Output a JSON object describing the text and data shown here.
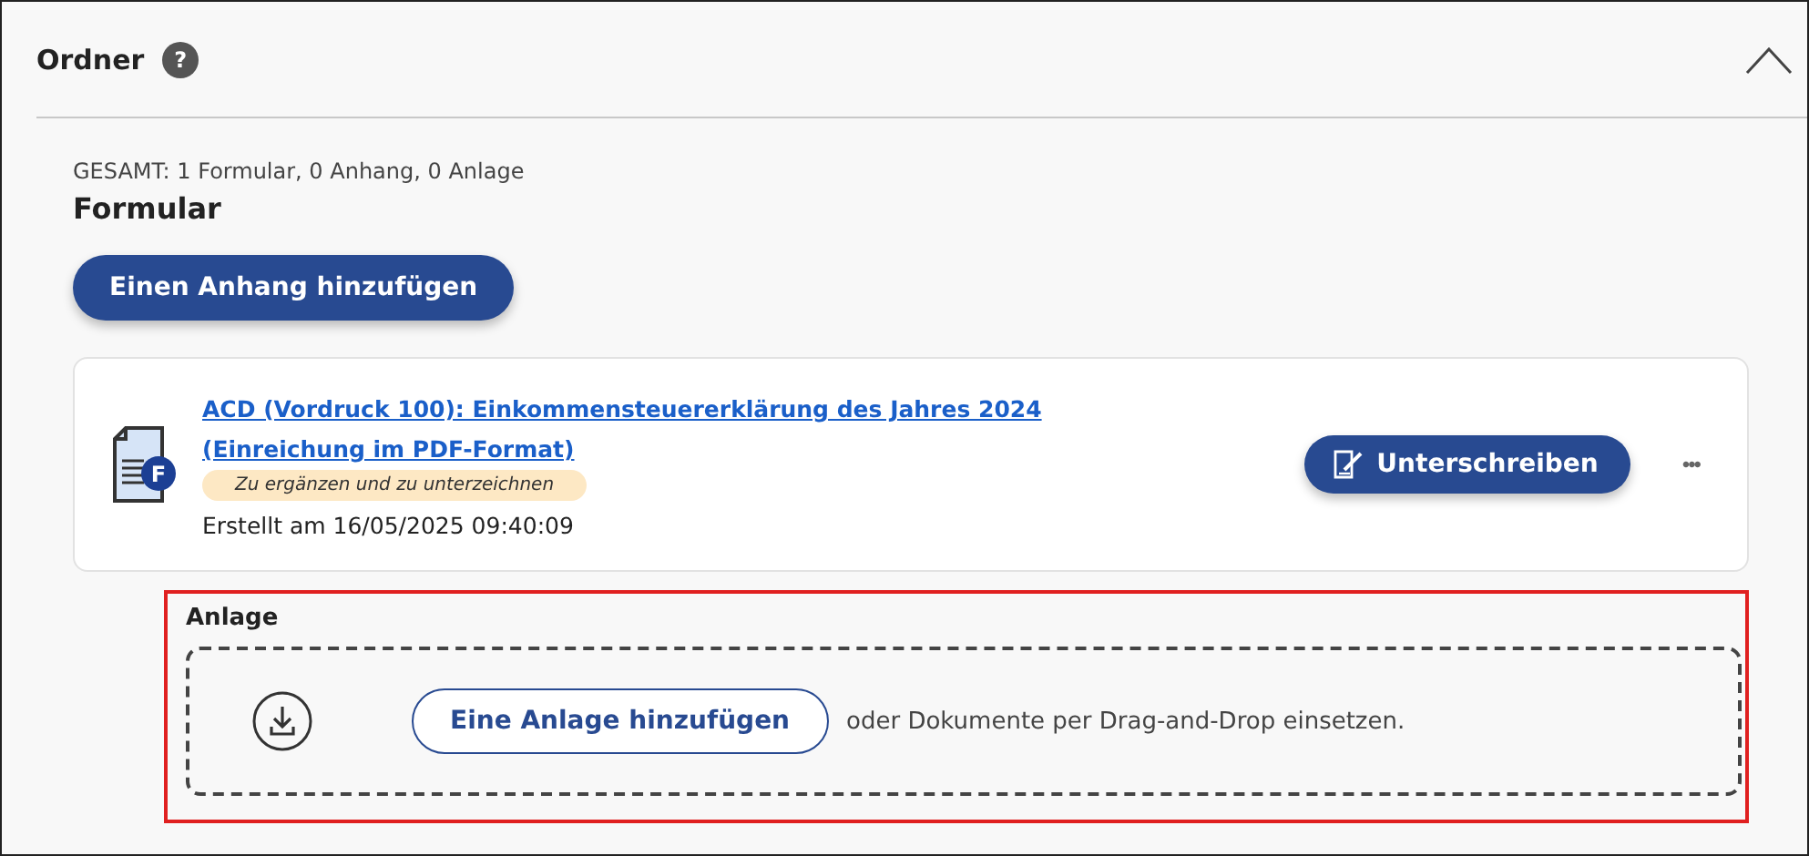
{
  "panel": {
    "title": "Ordner",
    "help_icon": "?",
    "expanded": true
  },
  "summary": "GESAMT: 1 Formular, 0 Anhang, 0 Anlage",
  "section_title": "Formular",
  "add_attachment_button": "Einen Anhang hinzufügen",
  "form_card": {
    "title_line_1": "ACD (Vordruck 100): Einkommensteuererklärung des Jahres 2024",
    "title_line_2": "(Einreichung im PDF-Format)",
    "file_badge": "F",
    "status": "Zu ergänzen und zu unterzeichnen",
    "created": "Erstellt am 16/05/2025 09:40:09",
    "sign_button": "Unterschreiben",
    "more_button": "•••"
  },
  "appendix": {
    "title": "Anlage",
    "highlighted": true,
    "add_button": "Eine Anlage hinzufügen",
    "drop_hint": "oder Dokumente per Drag-and-Drop einsetzen."
  }
}
